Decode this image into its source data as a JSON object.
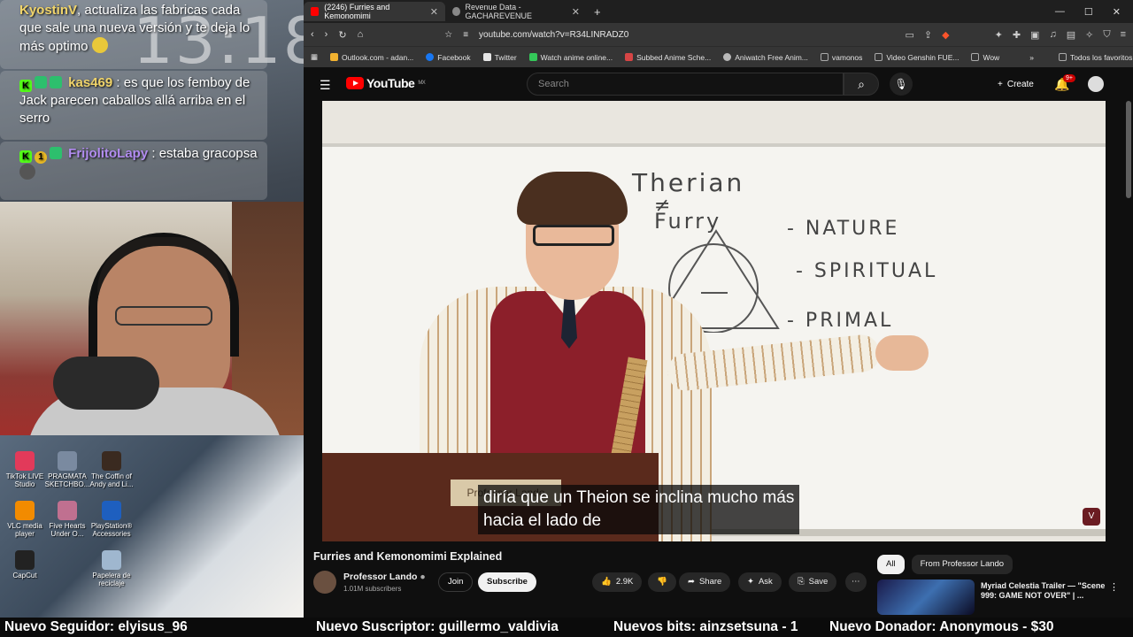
{
  "overlay": {
    "clock": "13:18",
    "chat": [
      {
        "user": "KyostinV",
        "text": "actualiza las fabricas cada que sale una nueva versión y te deja lo más optimo"
      },
      {
        "user": "kas469",
        "text": "es que los femboy de Jack parecen caballos allá arriba en el serro"
      },
      {
        "user": "FrijolitoLapy",
        "text": "estaba gracopsa"
      }
    ],
    "desktop_icons": [
      {
        "label": "TikTok LIVE Studio",
        "icon": "tiktok-icon",
        "color": "#e23a5a"
      },
      {
        "label": "PRAGMATA SKETCHBO...",
        "icon": "game-icon",
        "color": "#7a8aa0"
      },
      {
        "label": "The Coffin of Andy and Li...",
        "icon": "game-icon",
        "color": "#3a2a20"
      },
      {
        "label": "VLC media player",
        "icon": "vlc-icon",
        "color": "#f28b00"
      },
      {
        "label": "Five Hearts Under O...",
        "icon": "game-icon",
        "color": "#c07090"
      },
      {
        "label": "PlayStation® Accessories",
        "icon": "playstation-icon",
        "color": "#1e5fbf"
      },
      {
        "label": "CapCut",
        "icon": "capcut-icon",
        "color": "#222222"
      },
      {
        "label": "Papelera de reciclaje",
        "icon": "recycle-bin-icon",
        "color": "#9fb7cf"
      }
    ]
  },
  "browser": {
    "tabs": [
      {
        "title": "(2246) Furries and Kemonomimi",
        "active": true,
        "icon": "youtube-icon"
      },
      {
        "title": "Revenue Data - GACHAREVENUE",
        "active": false,
        "icon": "globe-icon"
      }
    ],
    "url": "youtube.com/watch?v=R34LINRADZ0",
    "bookmarks": [
      {
        "label": "Outlook.com - adan...",
        "color": "#f2b230"
      },
      {
        "label": "Facebook",
        "color": "#1877f2"
      },
      {
        "label": "Twitter",
        "color": "#e6e6e6"
      },
      {
        "label": "Watch anime online...",
        "color": "#34c759"
      },
      {
        "label": "Subbed Anime Sche...",
        "color": "#d64545"
      },
      {
        "label": "Aniwatch Free Anim...",
        "color": "#b8b8b8"
      },
      {
        "label": "vamonos",
        "color": "#888888"
      },
      {
        "label": "Video Genshin FUE...",
        "color": "#888888"
      },
      {
        "label": "Wow",
        "color": "#888888"
      }
    ],
    "bookmarks_all": "Todos los favoritos"
  },
  "youtube": {
    "logo": "YouTube",
    "region": "MX",
    "search_placeholder": "Search",
    "create_label": "Create",
    "notif_count": "9+",
    "video": {
      "board": {
        "l1": "Therian",
        "l2": "≠",
        "l3": "Furry",
        "n": "- NATURE",
        "s": "- SPIRITUAL",
        "p": "- PRIMAL"
      },
      "plate": "Professor Lando",
      "caption_line1": "diría que un Theion se inclina mucho más",
      "caption_line2": "hacia el lado de"
    },
    "title": "Furries and Kemonomimi Explained",
    "channel": "Professor Lando",
    "subscribers": "1.01M subscribers",
    "join_label": "Join",
    "subscribe_label": "Subscribe",
    "likes": "2.9K",
    "share_label": "Share",
    "ask_label": "Ask",
    "save_label": "Save",
    "chips": [
      "All",
      "From Professor Lando"
    ],
    "recommended": {
      "title": "Myriad Celestia Trailer — \"Scene 999: GAME NOT OVER\" | ..."
    }
  },
  "ticker": {
    "follower": "Nuevo Seguidor: elyisus_96",
    "subscriber": "Nuevo Suscriptor: guillermo_valdivia",
    "bits": "Nuevos bits: ainzsetsuna - 1",
    "donor": "Nuevo Donador: Anonymous - $30"
  }
}
